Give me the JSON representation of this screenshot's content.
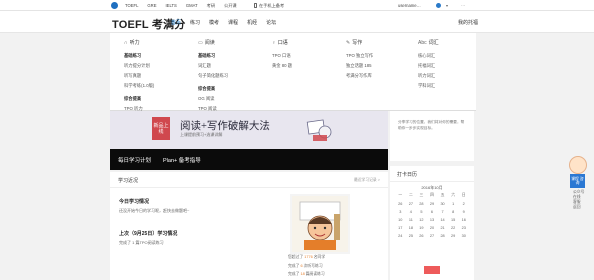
{
  "topbar": {
    "nav": [
      "TOEFL",
      "GRE",
      "IELTS",
      "GMAT",
      "考研",
      "公开课"
    ],
    "phone": "在手机上备考",
    "user": "username…",
    "dots": "···"
  },
  "header": {
    "brand": "TOEFL 考满分",
    "nav": [
      {
        "label": "首页",
        "active": true
      },
      {
        "label": "练习"
      },
      {
        "label": "模考"
      },
      {
        "label": "课程"
      },
      {
        "label": "机经"
      },
      {
        "label": "论坛"
      }
    ],
    "my_plan": "我的托福"
  },
  "mega": {
    "columns": [
      {
        "title": "听力",
        "icon": "headphones-icon",
        "items": [
          "基础练习",
          "听力提分计划",
          "听写真题",
          "科学考练(1.0版)",
          "",
          "综合提高",
          "TPO 听力"
        ]
      },
      {
        "title": "阅读",
        "icon": "book-icon",
        "items": [
          "基础练习",
          "词汇题",
          "句子简化题练习",
          "",
          "综合提高",
          "OG 阅读",
          "TPO 阅读"
        ]
      },
      {
        "title": "口语",
        "icon": "mic-icon",
        "items": [
          "TPO 口语",
          "黄金 80 题"
        ]
      },
      {
        "title": "写作",
        "icon": "pen-icon",
        "items": [
          "TPO 独立写作",
          "独立话题 185",
          "考满分写作库"
        ]
      },
      {
        "title": "词汇",
        "icon": "abc-icon",
        "items": [
          "核心词汇",
          "托福词汇",
          "听力词汇",
          "学科词汇"
        ]
      }
    ]
  },
  "banner": {
    "tag": "新品上线",
    "title": "阅读+写作破解大法",
    "sub": "上课提前预习+选课详解"
  },
  "plan_bar": {
    "item1": "每日学习计划",
    "item2": "Plan+ 备考指导"
  },
  "study": {
    "title": "学习近况",
    "right": "最近学习记录 >",
    "today_title": "今日学习情况",
    "today_text": "还没开始今日的学习呢，赶快去做题吧~",
    "last_title": "上次（9月25日）学习情况",
    "last_text": "完成了 1 篇TPO阅读练习",
    "stat1_pre": "您超过了",
    "stat1_num": "1776",
    "stat1_post": "名同学",
    "stat2_pre": "完成了",
    "stat2_num": "6",
    "stat2_post": "次听写练习",
    "stat3_pre": "完成了",
    "stat3_num": "18",
    "stat3_post": "篇阅读练习"
  },
  "right_panel": {
    "text": "分享学习的位置，我们将对你的需要，帮助你一步步实现目标。"
  },
  "calendar": {
    "title": "打卡日历",
    "month": "2016年10月",
    "weekdays": [
      "一",
      "二",
      "三",
      "四",
      "五",
      "六",
      "日"
    ],
    "days": [
      "26",
      "27",
      "28",
      "29",
      "30",
      "1",
      "2",
      "3",
      "4",
      "5",
      "6",
      "7",
      "8",
      "9",
      "10",
      "11",
      "12",
      "13",
      "14",
      "15",
      "16",
      "17",
      "18",
      "19",
      "20",
      "21",
      "22",
      "23",
      "24",
      "25",
      "26",
      "27",
      "28",
      "29",
      "30"
    ]
  },
  "float": {
    "tab": "课程 咨询",
    "links": [
      "公众号",
      "在线",
      "客服",
      "返回"
    ]
  }
}
